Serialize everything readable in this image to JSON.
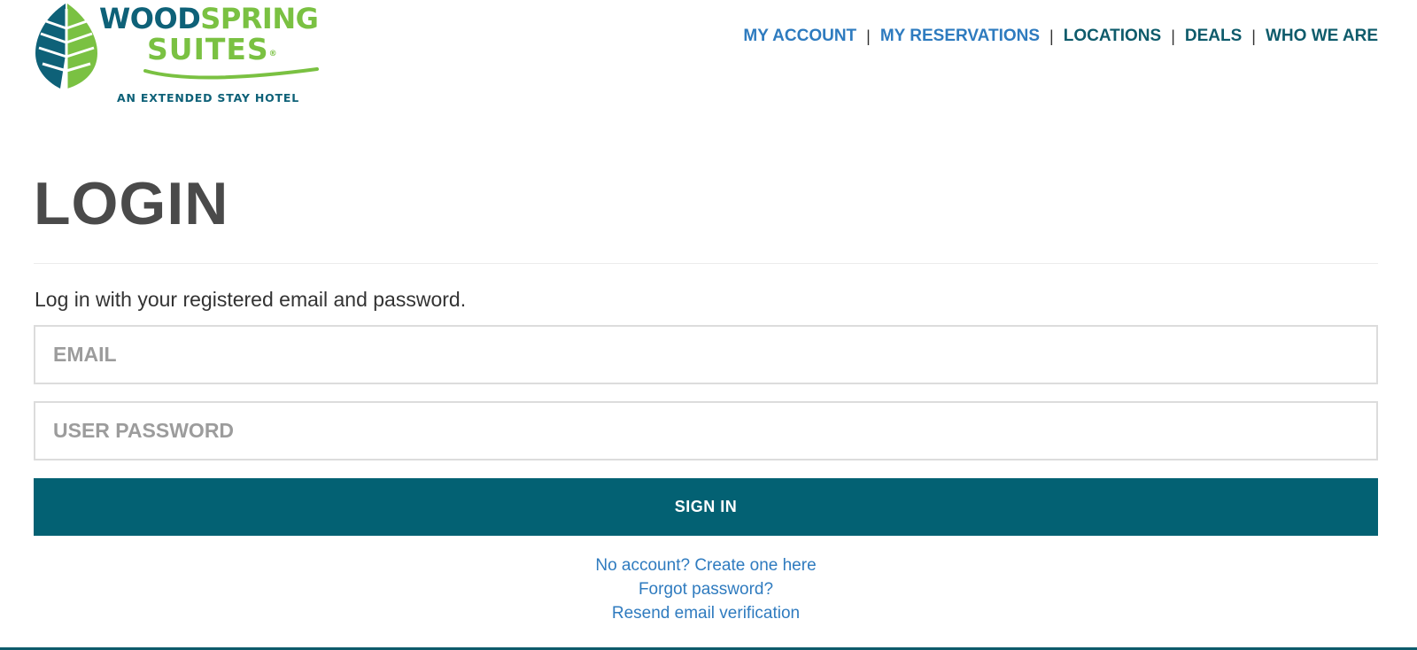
{
  "brand": {
    "name_part1": "WOOD",
    "name_part2": "SPRING",
    "name_line2": "SUITES",
    "registered_mark": "®",
    "tagline": "AN EXTENDED STAY HOTEL",
    "colors": {
      "teal": "#0e6178",
      "green": "#7ac142"
    }
  },
  "nav": {
    "items": [
      {
        "label": "MY ACCOUNT"
      },
      {
        "label": "MY RESERVATIONS"
      },
      {
        "label": "LOCATIONS"
      },
      {
        "label": "DEALS"
      },
      {
        "label": "WHO WE ARE"
      }
    ],
    "separator": "|"
  },
  "main": {
    "title": "LOGIN",
    "instructions": "Log in with your registered email and password.",
    "email": {
      "placeholder": "EMAIL",
      "value": ""
    },
    "password": {
      "placeholder": "USER PASSWORD",
      "value": ""
    },
    "submit_label": "SIGN IN",
    "links": {
      "create_account": "No account? Create one here",
      "forgot_password": "Forgot password?",
      "resend_verification": "Resend email verification"
    }
  },
  "colors": {
    "primary_button": "#036173",
    "link_blue": "#2f7bbf",
    "nav_teal": "#0e5b6b",
    "title_gray": "#4a4a4a"
  }
}
